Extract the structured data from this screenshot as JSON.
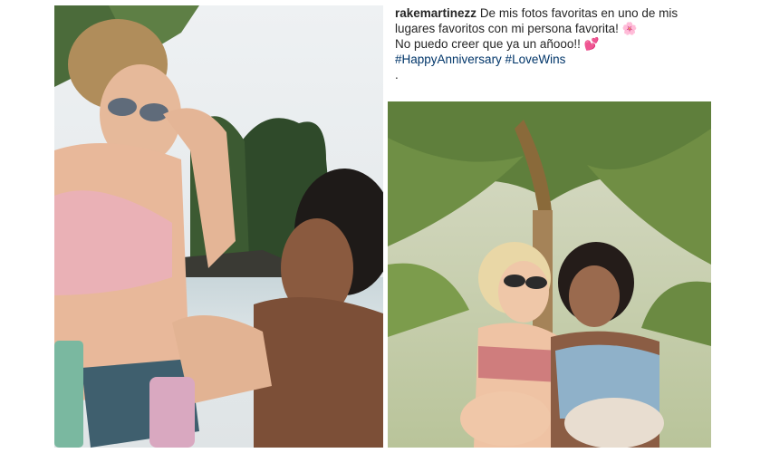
{
  "caption": {
    "username": "rakemartinezz",
    "line1": "De mis fotos favoritas en uno de mis",
    "line2": "lugares favoritos con mi persona favorita!",
    "line2_emoji": "🌸",
    "line3": "No puedo creer que ya un añooo!!",
    "line3_emoji": "💕",
    "hashtags": "#HappyAnniversary #LoveWins",
    "trailing": "."
  },
  "colors": {
    "text": "#262626",
    "hashtag": "#003569",
    "background": "#ffffff"
  },
  "photos": [
    {
      "name": "beach-photo-left",
      "icon": "photo-icon"
    },
    {
      "name": "palm-photo-right",
      "icon": "photo-icon"
    }
  ]
}
